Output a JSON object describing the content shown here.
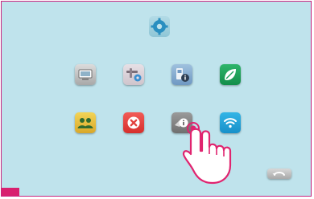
{
  "colors": {
    "background": "#bfe3ec",
    "frame_border": "#c8247e",
    "corner_mark": "#d8206f",
    "touch_highlight": "#e0246f"
  },
  "title_icon": "settings-gear-icon",
  "menu": {
    "row1": [
      {
        "icon": "monitor-icon",
        "color": "#b8b8b8"
      },
      {
        "icon": "tools-settings-icon",
        "color": "#d8d0d6"
      },
      {
        "icon": "device-info-icon",
        "color": "#86acd0"
      },
      {
        "icon": "leaf-icon",
        "color": "#1fa05a"
      }
    ],
    "row2": [
      {
        "icon": "users-icon",
        "color": "#e8c03c"
      },
      {
        "icon": "close-icon",
        "color": "#e2413e"
      },
      {
        "icon": "info-icon",
        "color": "#858585"
      },
      {
        "icon": "wifi-icon",
        "color": "#24a3d8"
      }
    ]
  },
  "selected_icon": "info-icon",
  "back_button_icon": "back-arrow-icon"
}
